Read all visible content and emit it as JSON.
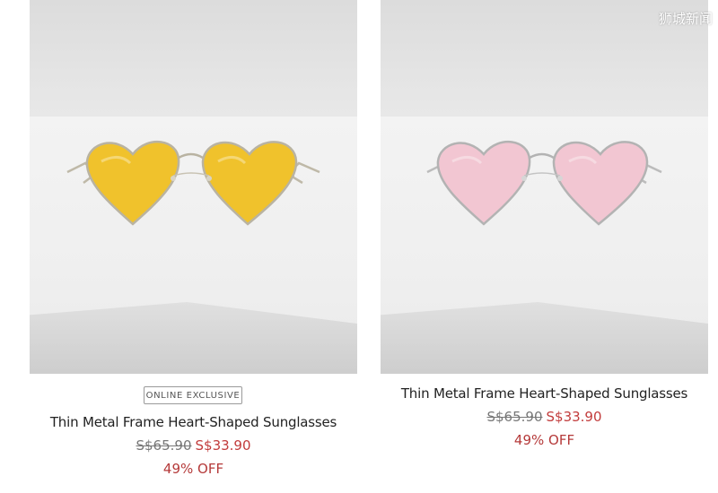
{
  "watermark": "狮城新闻",
  "products": [
    {
      "badge": "ONLINE EXCLUSIVE",
      "title": "Thin Metal Frame Heart-Shaped Sunglasses",
      "old_price": "S$65.90",
      "new_price": "S$33.90",
      "discount": "49% OFF",
      "lens_color": "#f0c22c"
    },
    {
      "title": "Thin Metal Frame Heart-Shaped Sunglasses",
      "old_price": "S$65.90",
      "new_price": "S$33.90",
      "discount": "49% OFF",
      "lens_color": "#f2c6d2"
    }
  ]
}
